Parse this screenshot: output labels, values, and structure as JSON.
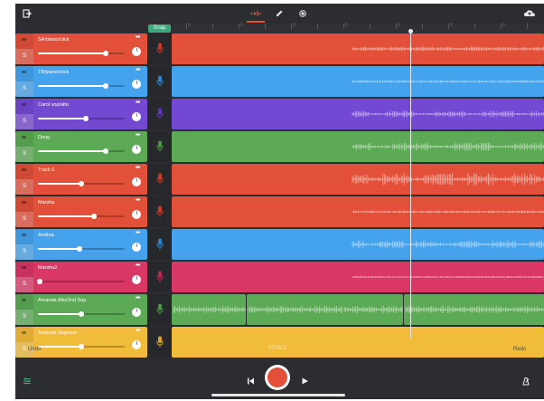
{
  "toolbar": {
    "icons": [
      "export-icon",
      "rhythm-icon",
      "pencil-icon",
      "gear-icon",
      "cloud-upload-icon"
    ]
  },
  "timeline": {
    "snap_label": "Snap",
    "ruler_labels": [
      "0",
      "",
      "0",
      "",
      "0",
      "",
      "0",
      "",
      "0",
      "",
      "0",
      "",
      "0",
      "",
      "0"
    ]
  },
  "tracks": [
    {
      "name": "SA/piano/click",
      "color": "#e2503a",
      "mic": "#c83a29",
      "volume": 0.78,
      "solo": "S"
    },
    {
      "name": "TB/piano/click",
      "color": "#45a3ee",
      "mic": "#2e82c9",
      "volume": 0.78,
      "solo": "S"
    },
    {
      "name": "Carol  sop/alto",
      "color": "#7348d3",
      "mic": "#5d36b9",
      "volume": 0.55,
      "solo": "S"
    },
    {
      "name": "Doug",
      "color": "#5caa55",
      "mic": "#4b9445",
      "volume": 0.78,
      "solo": "S"
    },
    {
      "name": "Track 6",
      "color": "#e2503a",
      "mic": "#c83a29",
      "volume": 0.5,
      "solo": "S"
    },
    {
      "name": "Marsha",
      "color": "#e2503a",
      "mic": "#c83a29",
      "volume": 0.65,
      "solo": "S"
    },
    {
      "name": "Andrea",
      "color": "#45a3ee",
      "mic": "#2e82c9",
      "volume": 0.48,
      "solo": "S"
    },
    {
      "name": "Marsha2",
      "color": "#d93766",
      "mic": "#b82852",
      "volume": 0.02,
      "solo": "S"
    },
    {
      "name": "Amanda Alto/2nd Sop",
      "color": "#5caa55",
      "mic": "#4b9445",
      "volume": 0.5,
      "solo": "S"
    },
    {
      "name": "Amanda Soprano",
      "color": "#f2bc3b",
      "mic": "#d9a22a",
      "volume": 0.5,
      "solo": "S"
    }
  ],
  "footer": {
    "undo_label": "Undo",
    "redo_label": "Redo",
    "time": "00:55.2"
  },
  "transport": {
    "icons": [
      "mixer-icon",
      "skip-back-icon",
      "record-icon",
      "play-icon",
      "metronome-icon"
    ],
    "record_color": "#e2503a"
  }
}
